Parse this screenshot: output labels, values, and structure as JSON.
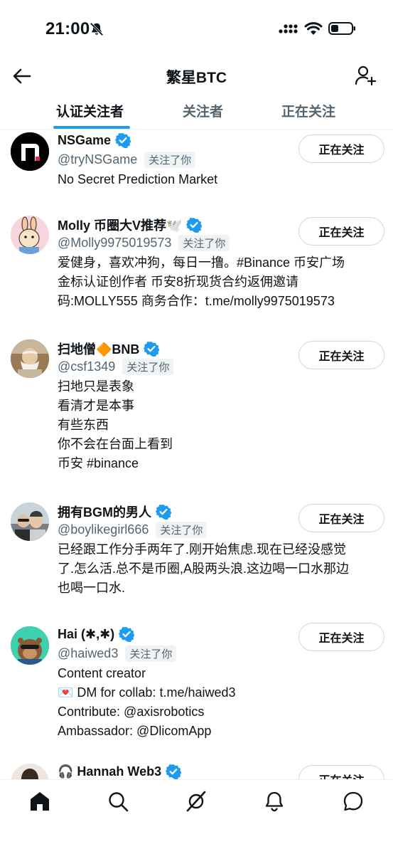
{
  "status_bar": {
    "time": "21:00"
  },
  "header": {
    "title": "繁星BTC"
  },
  "tabs": [
    {
      "label": "认证关注者"
    },
    {
      "label": "关注者"
    },
    {
      "label": "正在关注"
    }
  ],
  "users": [
    {
      "name": "NSGame",
      "handle": "@tryNSGame",
      "follows_you": "关注了你",
      "bio": "No Secret Prediction Market",
      "button": "正在关注"
    },
    {
      "name": "Molly 币圈大V推荐🕊️",
      "handle": "@Molly9975019573",
      "follows_you": "关注了你",
      "bio": "爱健身，喜欢冲狗，每日一撸。#Binance 币安广场\n金标认证创作者 币安8折现货合约返佣邀请\n码:MOLLY555 商务合作：t.me/molly9975019573",
      "button": "正在关注"
    },
    {
      "name": "扫地僧🔶BNB",
      "handle": "@csf1349",
      "follows_you": "关注了你",
      "bio": "扫地只是表象\n看清才是本事\n有些东西\n你不会在台面上看到\n币安 #binance",
      "button": "正在关注"
    },
    {
      "name": "拥有BGM的男人",
      "handle": "@boylikegirl666",
      "follows_you": "关注了你",
      "bio": "已经跟工作分手两年了.刚开始焦虑.现在已经没感觉\n了.怎么活.总不是币圈,A股两头浪.这边喝一口水那边\n也喝一口水.",
      "button": "正在关注"
    },
    {
      "name": "Hai (✱,✱)",
      "handle": "@haiwed3",
      "follows_you": "关注了你",
      "bio": "Content creator\n💌 DM for collab: t.me/haiwed3\nContribute: @axisrobotics\nAmbassador: @DlicomApp",
      "button": "正在关注"
    },
    {
      "name": "🎧 Hannah Web3",
      "handle": "",
      "follows_you": "",
      "bio": "",
      "button": "正在关注"
    }
  ],
  "colors": {
    "accent": "#1d9bf0",
    "text": "#0f1419",
    "secondary": "#536471"
  },
  "nav_icons": [
    "home-icon",
    "search-icon",
    "grok-icon",
    "notifications-icon",
    "messages-icon"
  ]
}
